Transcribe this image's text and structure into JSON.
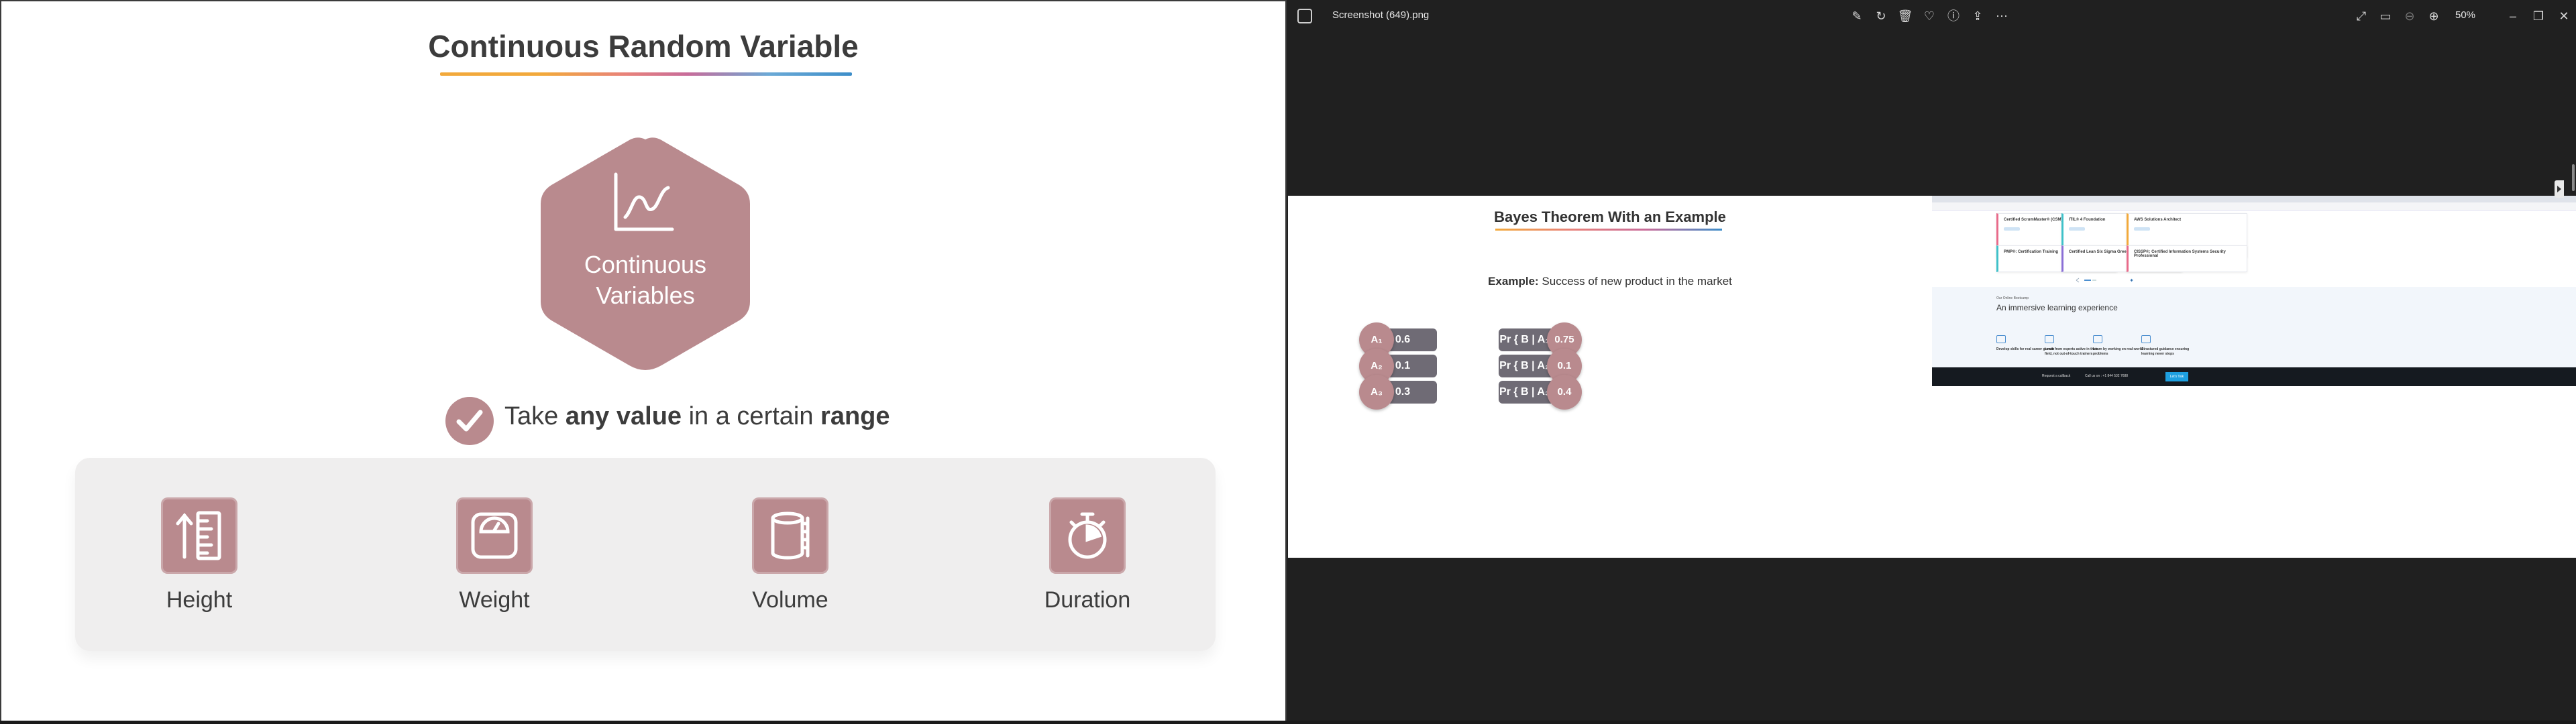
{
  "slide": {
    "title": "Continuous Random Variable",
    "hex_label_line1": "Continuous",
    "hex_label_line2": "Variables",
    "range_prefix": "Take ",
    "range_bold1": "any value",
    "range_mid": " in a certain ",
    "range_bold2": "range",
    "variables": [
      {
        "label": "Height",
        "icon": "height-ruler-icon"
      },
      {
        "label": "Weight",
        "icon": "weighing-scale-icon"
      },
      {
        "label": "Volume",
        "icon": "cylinder-volume-icon"
      },
      {
        "label": "Duration",
        "icon": "stopwatch-icon"
      }
    ],
    "colors": {
      "accent": "#b98a8e",
      "panel": "#efeeee",
      "text": "#3c3c3c"
    }
  },
  "viewer": {
    "filename": "Screenshot (649).png",
    "zoom": "50%",
    "toolbar_icons": [
      "edit-image-icon",
      "rotate-icon",
      "delete-icon",
      "favorite-icon",
      "info-icon",
      "share-icon",
      "more-icon"
    ],
    "right_icons": [
      "fullscreen-icon",
      "slideshow-icon",
      "zoom-out-icon",
      "zoom-in-icon"
    ],
    "window_controls": [
      "minimize-icon",
      "restore-icon",
      "close-icon"
    ]
  },
  "bayes": {
    "title": "Bayes Theorem With an Example",
    "example_bold": "Example:",
    "example_text": " Success of new product in the market",
    "rows": [
      {
        "event": "A₁",
        "prior": "0.6",
        "cond": "Pr { B | A₁ }",
        "likelihood": "0.75"
      },
      {
        "event": "A₂",
        "prior": "0.1",
        "cond": "Pr { B | A₂ }",
        "likelihood": "0.1"
      },
      {
        "event": "A₃",
        "prior": "0.3",
        "cond": "Pr { B | A₃ }",
        "likelihood": "0.4"
      }
    ]
  },
  "site": {
    "cards": [
      {
        "title": "Certified ScrumMaster® (CSM)",
        "color": "#e86b8a"
      },
      {
        "title": "ITIL® 4 Foundation",
        "color": "#3fc1c9"
      },
      {
        "title": "AWS Solutions Architect",
        "color": "#f2a93b"
      },
      {
        "title": "PMP®: Certification Training",
        "color": "#3fc1c9"
      },
      {
        "title": "Certified Lean Six Sigma Green Belt",
        "color": "#8b6fd6"
      },
      {
        "title": "CISSP®: Certified Information Systems Security Professional",
        "color": "#e86b8a"
      }
    ],
    "kicker": "Our Online Bootcamp",
    "heading": "An immersive learning experience",
    "features": [
      {
        "title": "Develop skills for real career growth"
      },
      {
        "title": "Learn from experts active in their field, not out-of-touch trainers"
      },
      {
        "title": "Learn by working on real-world problems"
      },
      {
        "title": "Structured guidance ensuring learning never stops"
      }
    ],
    "footer": {
      "callback": "Request a callback",
      "call": "Call us on : +1 844 532 7688",
      "enroll": "Let's Talk"
    }
  }
}
